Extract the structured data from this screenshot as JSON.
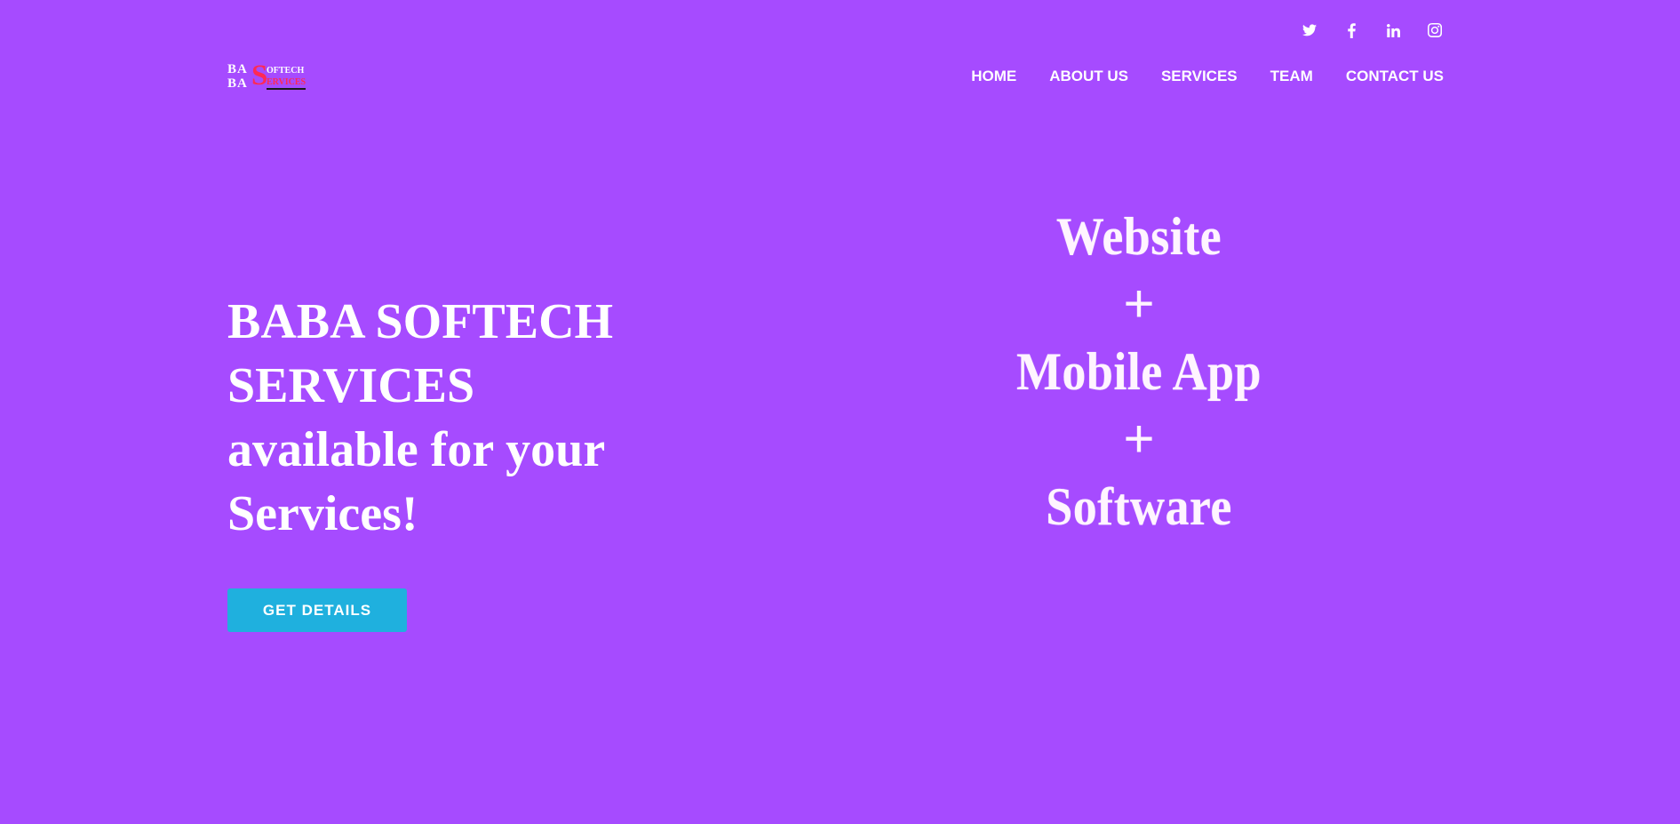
{
  "social": [
    {
      "name": "twitter",
      "icon": "twitter-icon"
    },
    {
      "name": "facebook",
      "icon": "facebook-icon"
    },
    {
      "name": "linkedin",
      "icon": "linkedin-icon"
    },
    {
      "name": "instagram",
      "icon": "instagram-icon"
    }
  ],
  "logo": {
    "ba_top": "BA",
    "ba_bottom": "BA",
    "big_letter": "S",
    "top_word": "OFTECH",
    "bottom_word": "ERVICES"
  },
  "nav": {
    "home": "HOME",
    "about": "ABOUT US",
    "services": "SERVICES",
    "team": "TEAM",
    "contact": "CONTACT US"
  },
  "hero": {
    "line1": "BABA SOFTECH",
    "line2": "SERVICES",
    "line3": "available for your",
    "line4": "Services!",
    "button": "GET DETAILS"
  },
  "stack": {
    "item1": "Website",
    "plus1": "+",
    "item2": "Mobile App",
    "plus2": "+",
    "item3": "Software"
  },
  "colors": {
    "background": "#a64bff",
    "button": "#1fb0de",
    "logo_accent": "#ff2a55",
    "text": "#ffffff"
  }
}
